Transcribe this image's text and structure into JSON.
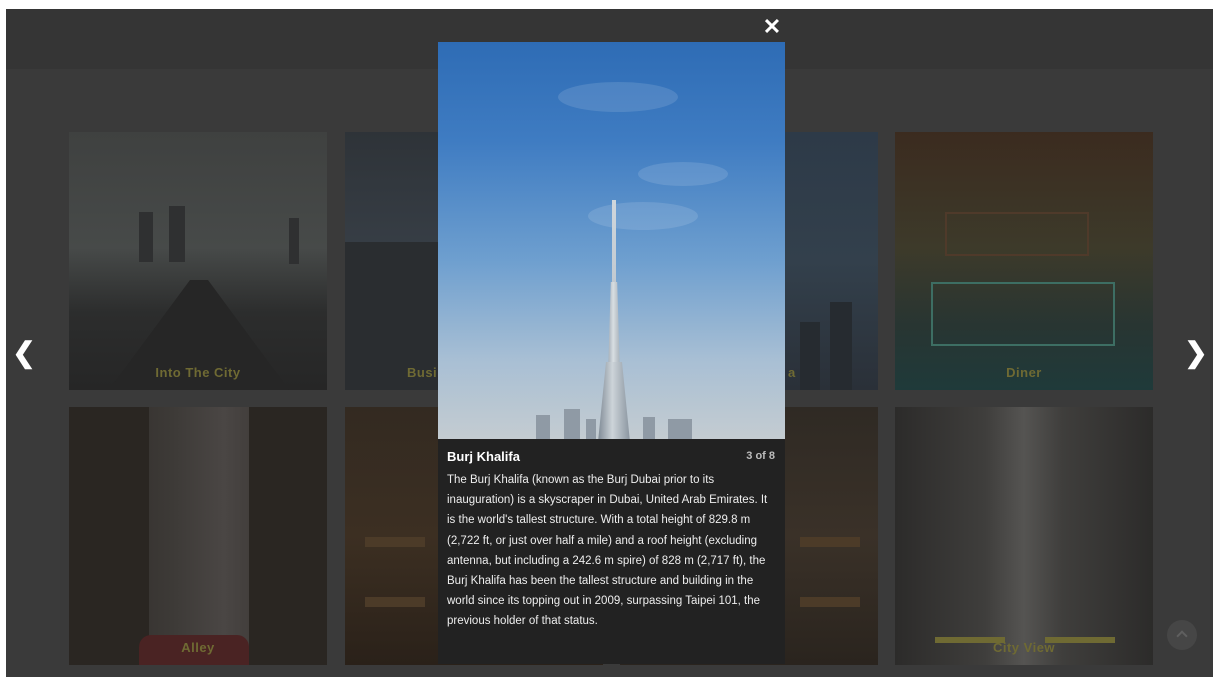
{
  "gallery": {
    "tiles": [
      {
        "caption": "Into The City"
      },
      {
        "caption": "Busi"
      },
      {
        "caption": "a"
      },
      {
        "caption": "Diner"
      },
      {
        "caption": "Alley"
      },
      {
        "caption": ""
      },
      {
        "caption": ""
      },
      {
        "caption": "City View"
      }
    ]
  },
  "lightbox": {
    "title": "Burj Khalifa",
    "counter": "3 of 8",
    "description": "The Burj Khalifa (known as the Burj Dubai prior to its inauguration) is a skyscraper in Dubai, United Arab Emirates. It is the world's tallest structure. With a total height of 829.8 m (2,722 ft, or just over half a mile) and a roof height (excluding antenna, but including a 242.6 m spire) of 828 m (2,717 ft), the Burj Khalifa has been the tallest structure and building in the world since its topping out in 2009, surpassing Taipei 101, the previous holder of that status.",
    "close_glyph": "✕",
    "prev_glyph": "❮",
    "next_glyph": "❯"
  },
  "icons": {
    "close": "close-icon",
    "prev": "chevron-left-icon",
    "next": "chevron-right-icon",
    "scroll_top": "chevron-up-icon"
  },
  "colors": {
    "overlay": "#3a3a3a",
    "caption_text": "#6f6a33",
    "lightbox_caption_bg": "#222222"
  }
}
